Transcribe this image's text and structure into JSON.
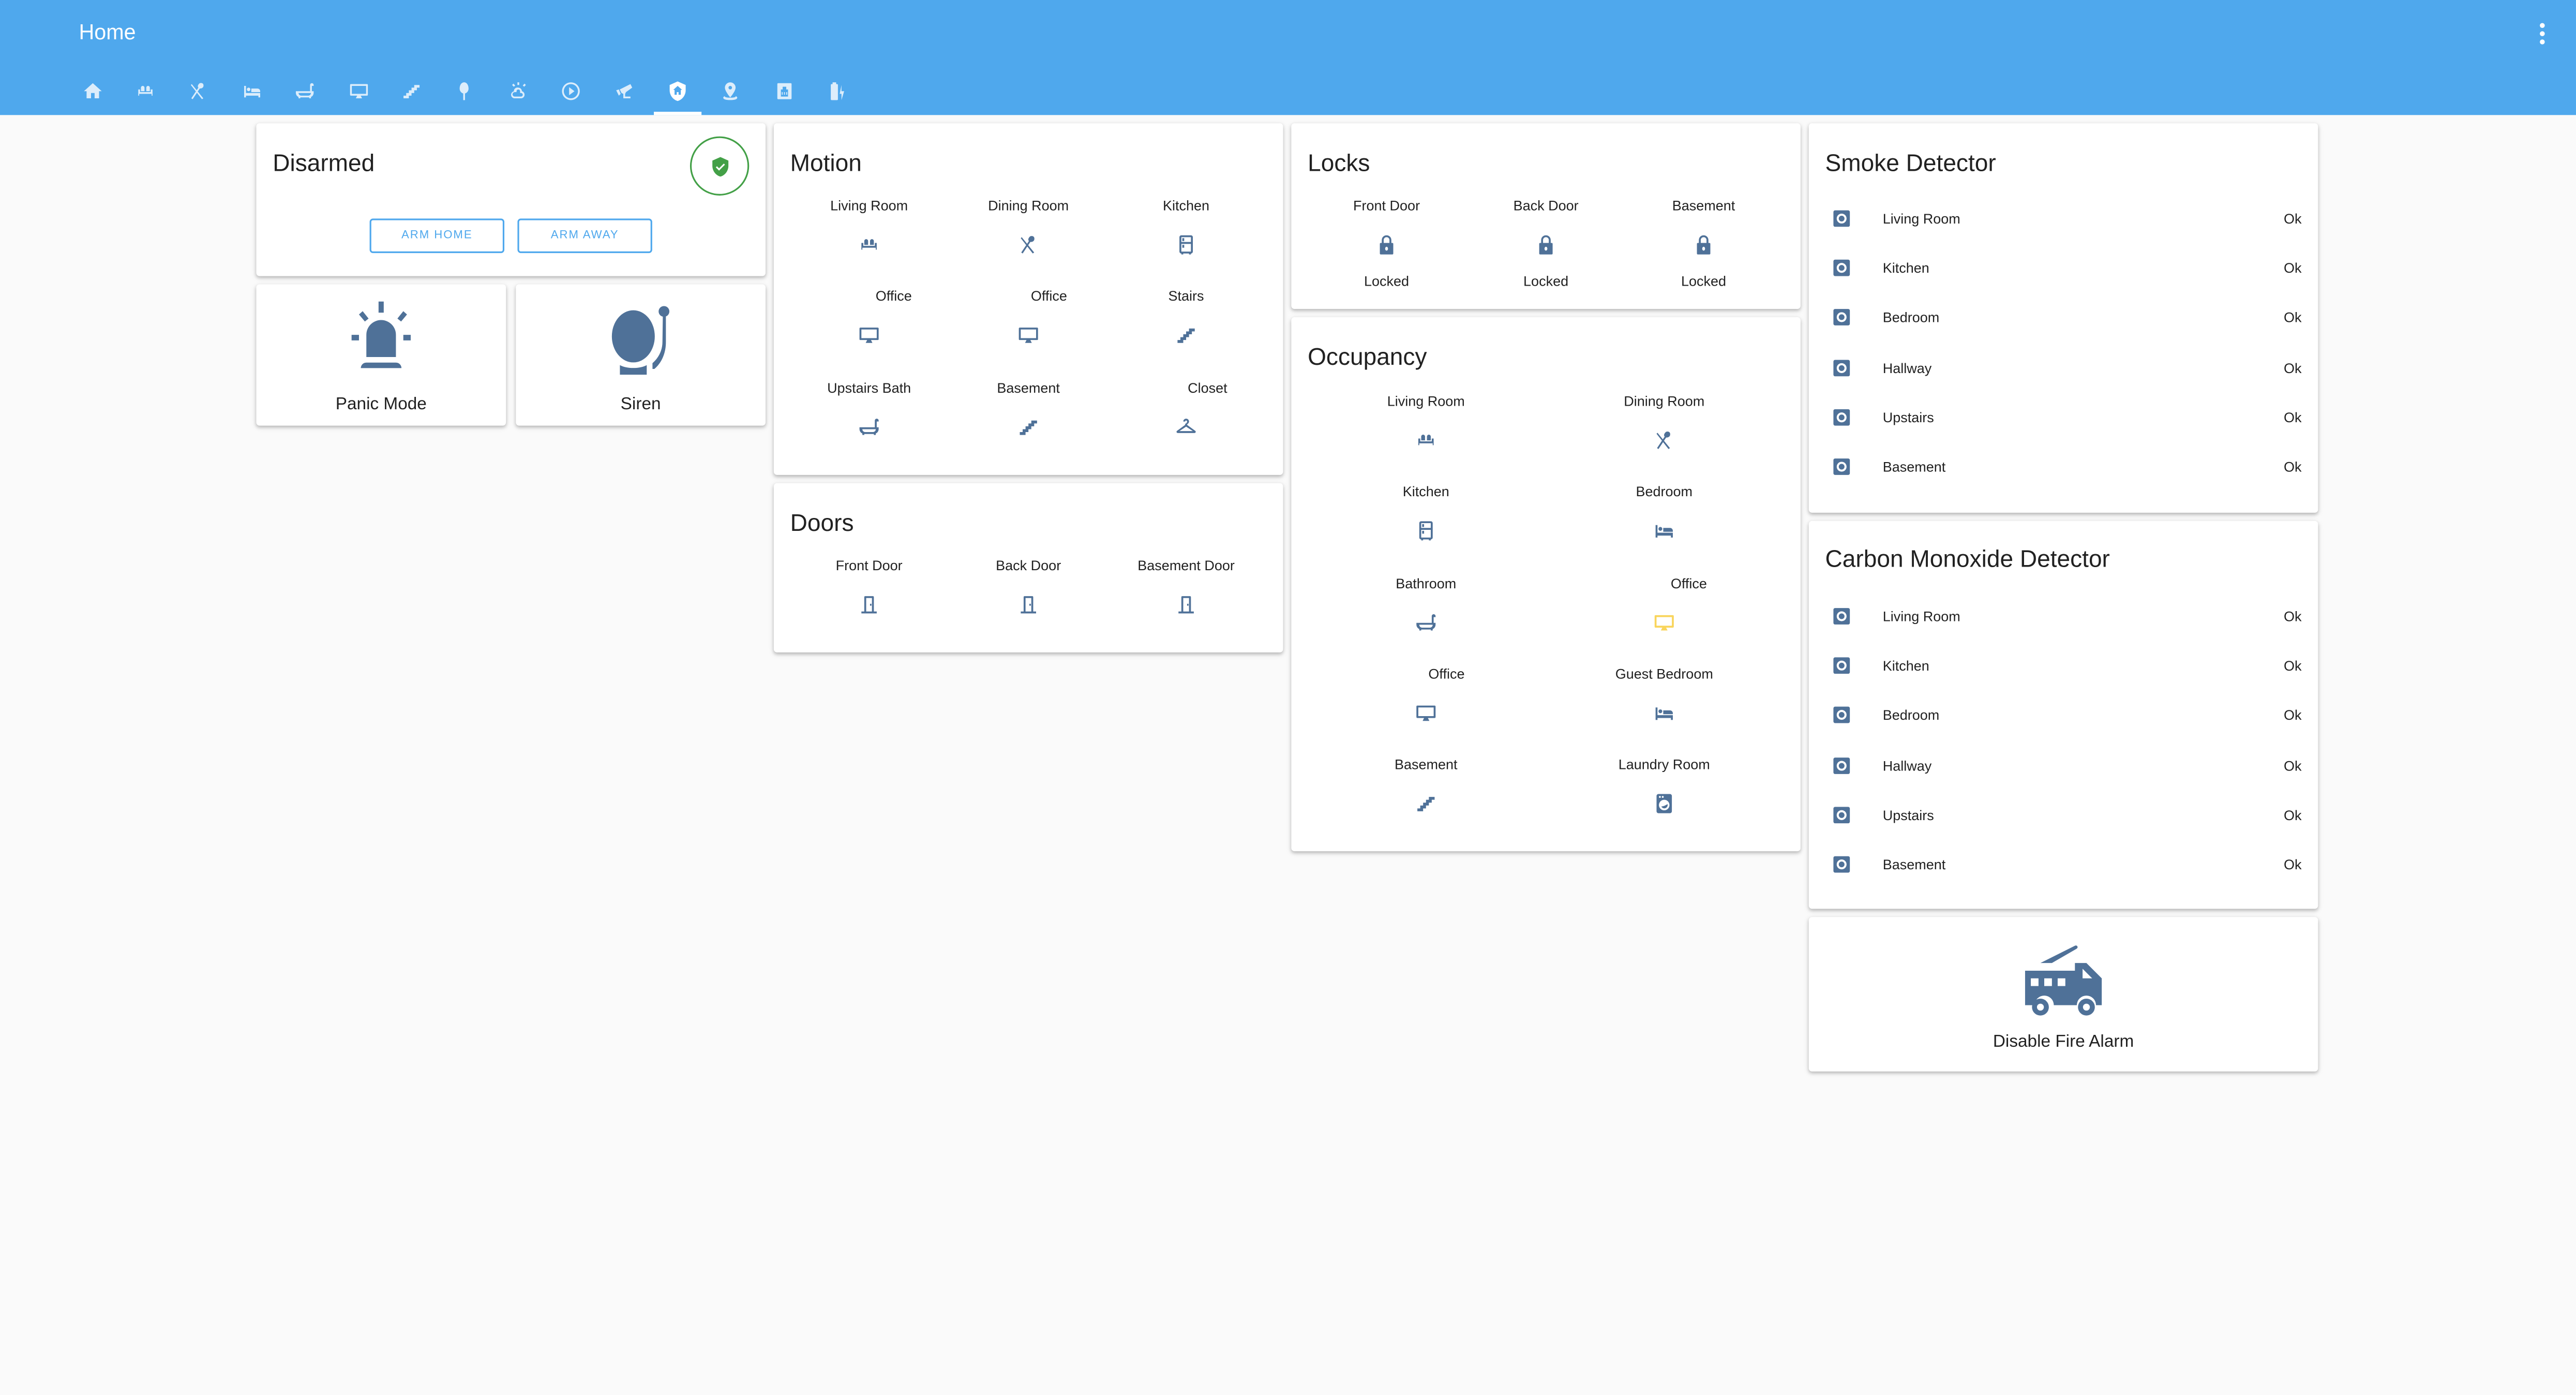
{
  "header": {
    "title": "Home",
    "menu_icon": "dots-vertical-icon",
    "tabs": [
      {
        "icon": "home-icon",
        "active": false
      },
      {
        "icon": "sofa-icon",
        "active": false
      },
      {
        "icon": "silverware-icon",
        "active": false
      },
      {
        "icon": "bed-icon",
        "active": false
      },
      {
        "icon": "bathtub-icon",
        "active": false
      },
      {
        "icon": "monitor-icon",
        "active": false
      },
      {
        "icon": "stairs-icon",
        "active": false
      },
      {
        "icon": "tree-icon",
        "active": false
      },
      {
        "icon": "weather-icon",
        "active": false
      },
      {
        "icon": "play-circle-icon",
        "active": false
      },
      {
        "icon": "cctv-icon",
        "active": false
      },
      {
        "icon": "shield-home-icon",
        "active": true
      },
      {
        "icon": "map-marker-radius-icon",
        "active": false
      },
      {
        "icon": "ethernet-icon",
        "active": false
      },
      {
        "icon": "battery-charging-icon",
        "active": false
      }
    ]
  },
  "colors": {
    "header": "#4fa8ed",
    "icon": "#4f7198",
    "icon_active": "#f9d55c",
    "disarmed_green": "#43a047",
    "background": "#fafafa"
  },
  "alarm": {
    "state": "Disarmed",
    "arm_home_label": "ARM HOME",
    "arm_away_label": "ARM AWAY"
  },
  "panic": {
    "label": "Panic Mode"
  },
  "siren": {
    "label": "Siren"
  },
  "motion": {
    "title": "Motion",
    "items": [
      {
        "label": "Living Room",
        "icon": "sofa-icon"
      },
      {
        "label": "Dining Room",
        "icon": "silverware-icon"
      },
      {
        "label": "Kitchen",
        "icon": "fridge-icon"
      },
      {
        "label": "Office",
        "icon": "monitor-icon"
      },
      {
        "label": "Office",
        "icon": "monitor-icon"
      },
      {
        "label": "Stairs",
        "icon": "stairs-icon"
      },
      {
        "label": "Upstairs Bath",
        "icon": "bathtub-icon"
      },
      {
        "label": "Basement",
        "icon": "stairs-icon"
      },
      {
        "label": "Closet",
        "icon": "hanger-icon"
      }
    ]
  },
  "doors": {
    "title": "Doors",
    "items": [
      {
        "label": "Front Door",
        "icon": "door-icon"
      },
      {
        "label": "Back Door",
        "icon": "door-icon"
      },
      {
        "label": "Basement Door",
        "icon": "door-icon"
      }
    ]
  },
  "locks": {
    "title": "Locks",
    "items": [
      {
        "label": "Front Door",
        "state": "Locked",
        "icon": "lock-icon"
      },
      {
        "label": "Back Door",
        "state": "Locked",
        "icon": "lock-icon"
      },
      {
        "label": "Basement",
        "state": "Locked",
        "icon": "lock-icon"
      }
    ]
  },
  "occupancy": {
    "title": "Occupancy",
    "items": [
      {
        "label": "Living Room",
        "icon": "sofa-icon",
        "active": false
      },
      {
        "label": "Dining Room",
        "icon": "silverware-icon",
        "active": false
      },
      {
        "label": "Kitchen",
        "icon": "fridge-icon",
        "active": false
      },
      {
        "label": "Bedroom",
        "icon": "bed-icon",
        "active": false
      },
      {
        "label": "Bathroom",
        "icon": "bathtub-icon",
        "active": false
      },
      {
        "label": "Office",
        "icon": "monitor-icon",
        "active": true
      },
      {
        "label": "Office",
        "icon": "monitor-icon",
        "active": false
      },
      {
        "label": "Guest Bedroom",
        "icon": "bed-icon",
        "active": false
      },
      {
        "label": "Basement",
        "icon": "stairs-icon",
        "active": false
      },
      {
        "label": "Laundry Room",
        "icon": "washing-machine-icon",
        "active": false
      }
    ]
  },
  "smoke": {
    "title": "Smoke Detector",
    "rows": [
      {
        "name": "Living Room",
        "state": "Ok"
      },
      {
        "name": "Kitchen",
        "state": "Ok"
      },
      {
        "name": "Bedroom",
        "state": "Ok"
      },
      {
        "name": "Hallway",
        "state": "Ok"
      },
      {
        "name": "Upstairs",
        "state": "Ok"
      },
      {
        "name": "Basement",
        "state": "Ok"
      }
    ]
  },
  "co": {
    "title": "Carbon Monoxide Detector",
    "rows": [
      {
        "name": "Living Room",
        "state": "Ok"
      },
      {
        "name": "Kitchen",
        "state": "Ok"
      },
      {
        "name": "Bedroom",
        "state": "Ok"
      },
      {
        "name": "Hallway",
        "state": "Ok"
      },
      {
        "name": "Upstairs",
        "state": "Ok"
      },
      {
        "name": "Basement",
        "state": "Ok"
      }
    ]
  },
  "fire": {
    "label": "Disable Fire Alarm"
  }
}
